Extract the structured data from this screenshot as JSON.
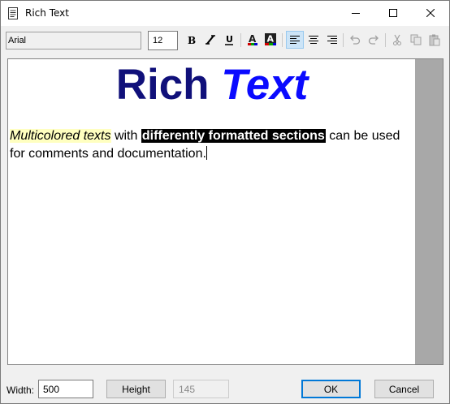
{
  "window": {
    "title": "Rich Text"
  },
  "toolbar": {
    "font_name": "Arial",
    "font_size": "12",
    "buttons": [
      {
        "name": "bold-icon",
        "label": "B"
      },
      {
        "name": "italic-icon",
        "label": "I"
      },
      {
        "name": "underline-icon",
        "label": "U"
      },
      {
        "name": "text-color-icon",
        "label": "A"
      },
      {
        "name": "background-color-icon",
        "label": "A"
      },
      {
        "name": "align-left-icon",
        "label": ""
      },
      {
        "name": "align-center-icon",
        "label": ""
      },
      {
        "name": "align-right-icon",
        "label": ""
      },
      {
        "name": "undo-icon",
        "label": ""
      },
      {
        "name": "redo-icon",
        "label": ""
      },
      {
        "name": "cut-icon",
        "label": ""
      },
      {
        "name": "copy-icon",
        "label": ""
      },
      {
        "name": "paste-icon",
        "label": ""
      }
    ],
    "active_alignment": "left"
  },
  "editor": {
    "headline_part1": "Rich ",
    "headline_part2": "Text",
    "segments": {
      "s1": "Multicolored texts",
      "s2": " with ",
      "s3": "differently formatted sections",
      "s4": " can be used for comments and documentation."
    },
    "colors": {
      "headline_dark": "#10107a",
      "headline_blue": "#0a0aff",
      "highlight_yellow": "#ffffc0",
      "highlight_black": "#000000"
    }
  },
  "footer": {
    "width_label": "Width:",
    "width_value": "500",
    "height_button": "Height",
    "height_value": "145",
    "ok_label": "OK",
    "cancel_label": "Cancel"
  }
}
